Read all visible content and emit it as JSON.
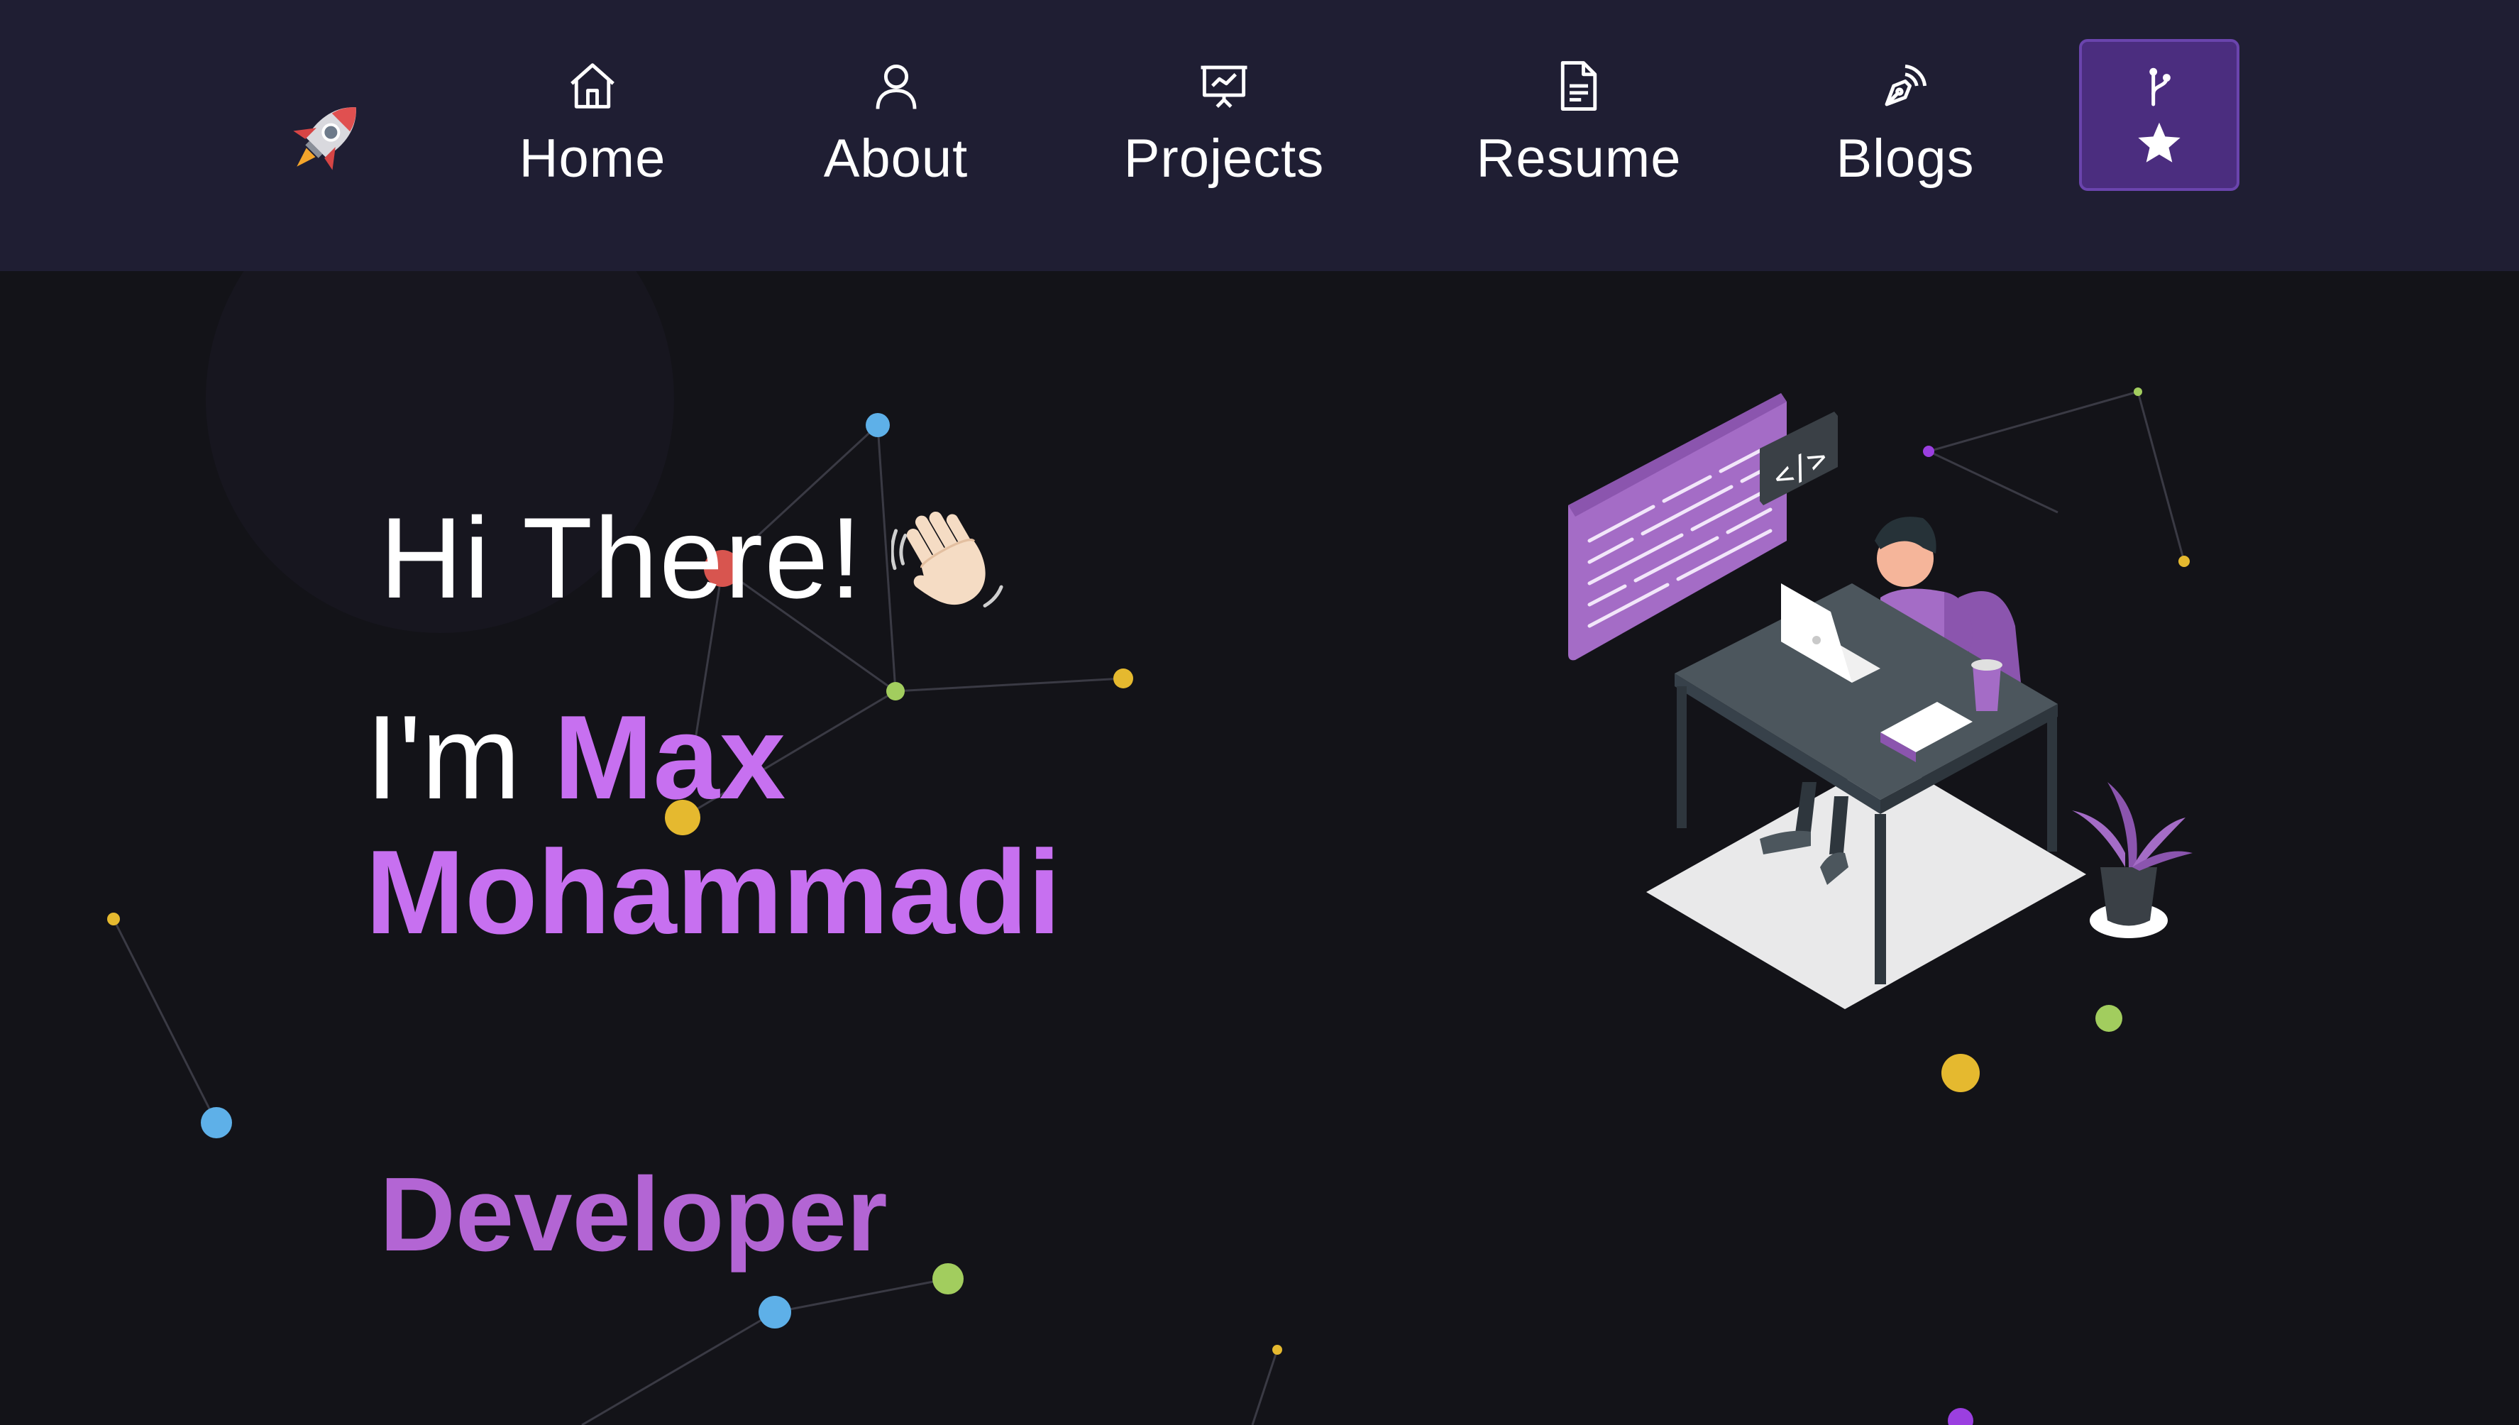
{
  "navbar": {
    "logo_icon": "rocket-icon",
    "items": [
      {
        "label": "Home",
        "icon": "home-icon"
      },
      {
        "label": "About",
        "icon": "user-icon"
      },
      {
        "label": "Projects",
        "icon": "presentation-chart-icon"
      },
      {
        "label": "Resume",
        "icon": "document-icon"
      },
      {
        "label": "Blogs",
        "icon": "pen-nib-icon"
      }
    ],
    "fork_button": {
      "icons": [
        "git-fork-icon",
        "star-icon"
      ]
    }
  },
  "hero": {
    "greeting": "Hi There!",
    "greeting_icon": "waving-hand-icon",
    "intro_prefix": "I'm",
    "name_line1": "Max",
    "name_line2": "Mohammadi",
    "role": "Developer",
    "illustration": "developer-at-desk-illustration"
  },
  "colors": {
    "navbar_bg": "#1f1e33",
    "page_bg": "#131318",
    "accent": "#c770f0",
    "role_text": "#b365d4",
    "fork_button_bg": "#4b2d7f"
  }
}
